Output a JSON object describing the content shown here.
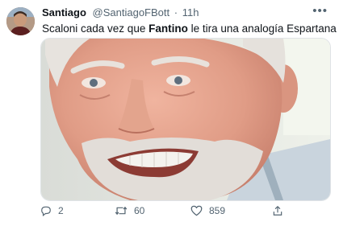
{
  "tweet": {
    "author_name": "Santiago",
    "handle": "@SantiagoFBott",
    "separator": "·",
    "time": "11h",
    "more_label": "•••",
    "text_before": "Scaloni cada vez que ",
    "text_bold": "Fantino",
    "text_after": " le tira una analogía Espartana",
    "media_icon": "meme-photo-smiling-older-man"
  },
  "actions": {
    "reply": {
      "icon": "reply-icon",
      "count": "2"
    },
    "retweet": {
      "icon": "retweet-icon",
      "count": "60"
    },
    "like": {
      "icon": "heart-icon",
      "count": "859"
    },
    "share": {
      "icon": "share-icon"
    }
  },
  "colors": {
    "text_primary": "#0f1419",
    "text_secondary": "#536471",
    "border": "#dfe3e6"
  }
}
